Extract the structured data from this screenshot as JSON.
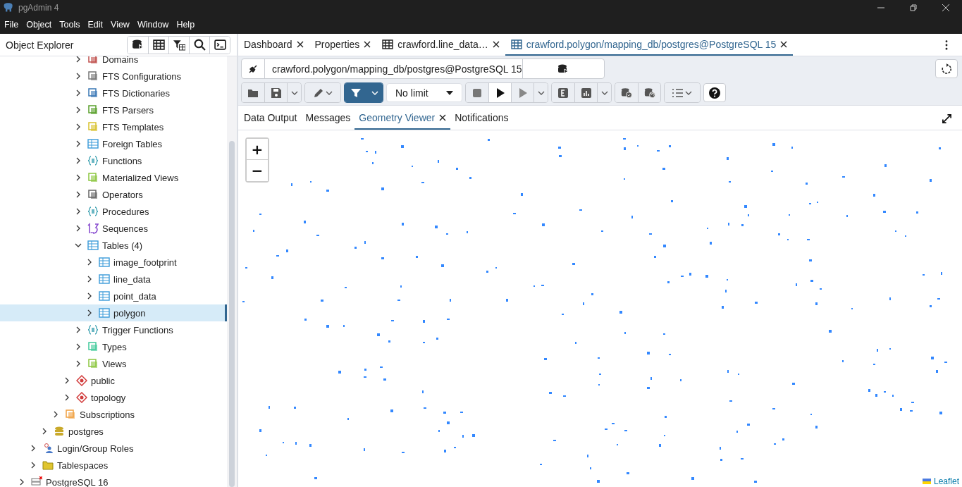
{
  "window": {
    "title": "pgAdmin 4"
  },
  "menu": [
    "File",
    "Object",
    "Tools",
    "Edit",
    "View",
    "Window",
    "Help"
  ],
  "object_explorer": {
    "title": "Object Explorer",
    "tree": [
      {
        "children": [
          {
            "children": [
              {
                "children": [
                  {
                    "children": [
                      {
                        "children": [
                          {
                            "label": "Domains",
                            "kind": "domain",
                            "expanded": false,
                            "selected": false
                          },
                          {
                            "label": "FTS Configurations",
                            "kind": "document",
                            "expanded": false,
                            "selected": false
                          },
                          {
                            "label": "FTS Dictionaries",
                            "kind": "books",
                            "expanded": false,
                            "selected": false
                          },
                          {
                            "label": "FTS Parsers",
                            "kind": "letters",
                            "expanded": false,
                            "selected": false
                          },
                          {
                            "label": "FTS Templates",
                            "kind": "template",
                            "expanded": false,
                            "selected": false
                          },
                          {
                            "label": "Foreign Tables",
                            "kind": "table",
                            "expanded": false,
                            "selected": false
                          },
                          {
                            "label": "Functions",
                            "kind": "braces",
                            "expanded": false,
                            "selected": false
                          },
                          {
                            "label": "Materialized Views",
                            "kind": "view",
                            "expanded": false,
                            "selected": false
                          },
                          {
                            "label": "Operators",
                            "kind": "operator",
                            "expanded": false,
                            "selected": false
                          },
                          {
                            "label": "Procedures",
                            "kind": "braces",
                            "expanded": false,
                            "selected": false
                          },
                          {
                            "label": "Sequences",
                            "kind": "sequence",
                            "expanded": false,
                            "selected": false
                          },
                          {
                            "label": "Tables (4)",
                            "kind": "table",
                            "expanded": true,
                            "selected": false,
                            "children": [
                              {
                                "label": "image_footprint",
                                "kind": "table",
                                "expanded": false,
                                "selected": false
                              },
                              {
                                "label": "line_data",
                                "kind": "table",
                                "expanded": false,
                                "selected": false
                              },
                              {
                                "label": "point_data",
                                "kind": "table",
                                "expanded": false,
                                "selected": false
                              },
                              {
                                "label": "polygon",
                                "kind": "table",
                                "expanded": false,
                                "selected": true
                              }
                            ]
                          },
                          {
                            "label": "Trigger Functions",
                            "kind": "braces",
                            "expanded": false,
                            "selected": false
                          },
                          {
                            "label": "Types",
                            "kind": "type",
                            "expanded": false,
                            "selected": false
                          },
                          {
                            "label": "Views",
                            "kind": "view",
                            "expanded": false,
                            "selected": false
                          }
                        ]
                      },
                      {
                        "label": "public",
                        "kind": "schema",
                        "expanded": false,
                        "selected": false
                      },
                      {
                        "label": "topology",
                        "kind": "schema",
                        "expanded": false,
                        "selected": false
                      }
                    ]
                  },
                  {
                    "label": "Subscriptions",
                    "kind": "subscription",
                    "expanded": false,
                    "selected": false
                  }
                ]
              },
              {
                "label": "postgres",
                "kind": "database",
                "expanded": false,
                "selected": false
              }
            ]
          },
          {
            "label": "Login/Group Roles",
            "kind": "roles",
            "expanded": false,
            "selected": false
          },
          {
            "label": "Tablespaces",
            "kind": "folder",
            "expanded": false,
            "selected": false
          }
        ]
      },
      {
        "label": "PostgreSQL 16",
        "kind": "server",
        "expanded": false,
        "selected": false
      }
    ]
  },
  "tabs": [
    {
      "label": "Dashboard",
      "table_icon": false,
      "selected": false
    },
    {
      "label": "Properties",
      "table_icon": false,
      "selected": false
    },
    {
      "label": "crawford.line_data…",
      "table_icon": true,
      "selected": false
    },
    {
      "label": "crawford.polygon/mapping_db/postgres@PostgreSQL 15",
      "table_icon": true,
      "selected": true
    }
  ],
  "connection": {
    "value": "crawford.polygon/mapping_db/postgres@PostgreSQL 15"
  },
  "limit": {
    "value": "No limit"
  },
  "result_tabs": [
    {
      "label": "Data Output",
      "closable": false,
      "selected": false
    },
    {
      "label": "Messages",
      "closable": false,
      "selected": false
    },
    {
      "label": "Geometry Viewer",
      "closable": true,
      "selected": true
    },
    {
      "label": "Notifications",
      "closable": false,
      "selected": false
    }
  ],
  "map": {
    "zoom_in": "+",
    "zoom_out": "−",
    "attribution": "Leaflet"
  }
}
